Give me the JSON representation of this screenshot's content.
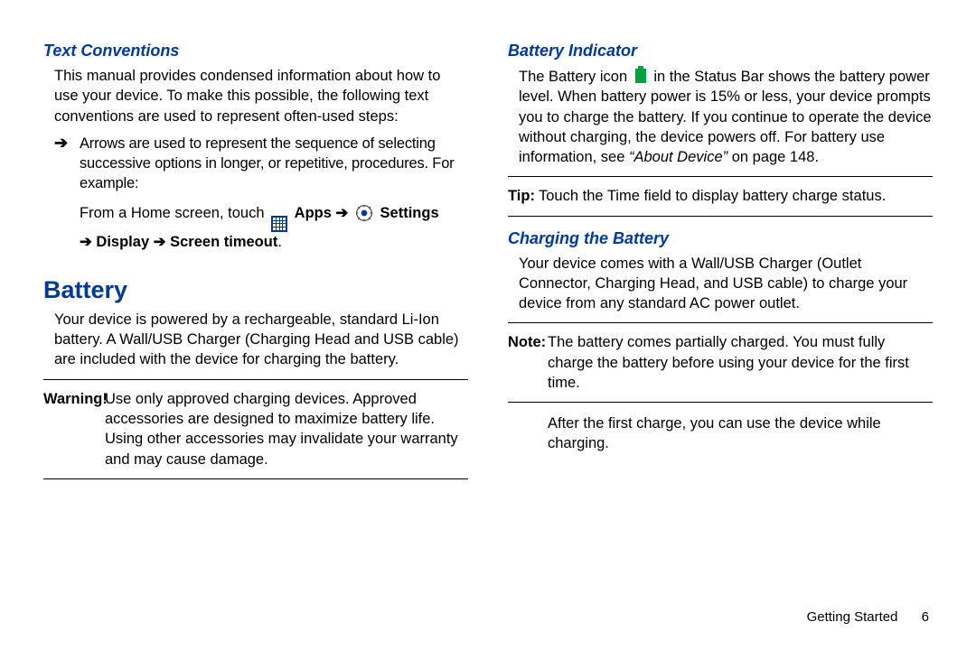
{
  "left": {
    "h_textconv": "Text Conventions",
    "textconv_p": "This manual provides condensed information about how to use your device. To make this possible, the following text conventions are used to represent often-used steps:",
    "arrow_glyph": "➔",
    "bullet_text": "Arrows are used to represent the sequence of selecting successive options in longer, or repetitive, procedures. For example:",
    "example_pre": "From a Home screen, touch ",
    "apps_label": " Apps ",
    "settings_label": " Settings",
    "example_line2a": " Display ",
    "example_line2b": " Screen timeout",
    "period": ".",
    "h_battery": "Battery",
    "battery_p": "Your device is powered by a rechargeable, standard Li-Ion battery. A Wall/USB Charger (Charging Head and USB cable) are included with the device for charging the battery.",
    "warning_label": "Warning!",
    "warning_text": " Use only approved charging devices. Approved accessories are designed to maximize battery life. Using other accessories may invalidate your warranty and may cause damage."
  },
  "right": {
    "h_indicator": "Battery Indicator",
    "indicator_pre": "The Battery icon ",
    "indicator_post": " in the Status Bar shows the battery power level. When battery power is 15% or less, your device prompts you to charge the battery. If you continue to operate the device without charging, the device powers off. For battery use information, see ",
    "about_device": "“About Device”",
    "on_page": " on page 148.",
    "tip_label": "Tip:",
    "tip_text": " Touch the Time field to display battery charge status.",
    "h_charging": "Charging the Battery",
    "charging_p": "Your device comes with a Wall/USB Charger (Outlet Connector, Charging Head, and USB cable) to charge your device from any standard AC power outlet.",
    "note_label": "Note:",
    "note_text": " The battery comes partially charged. You must fully charge the battery before using your device for the first time.",
    "after_note": "After the first charge, you can use the device while charging."
  },
  "footer": {
    "section": "Getting Started",
    "page": "6"
  }
}
